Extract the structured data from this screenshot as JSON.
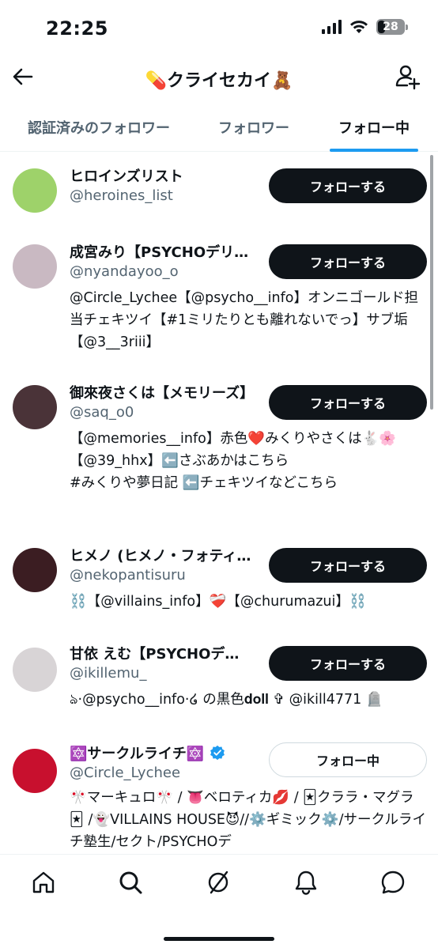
{
  "status": {
    "time": "22:25",
    "battery": "28",
    "battery_level_percent": 28
  },
  "header": {
    "title": "💊クライセカイ🧸"
  },
  "tabs": [
    {
      "label": "認証済みのフォロワー",
      "active": false
    },
    {
      "label": "フォロワー",
      "active": false
    },
    {
      "label": "フォロー中",
      "active": true
    }
  ],
  "users": [
    {
      "name": "ヒロインズリスト",
      "handle": "@heroines_list",
      "bio": "",
      "button": "フォローする",
      "avatar_color": "#9ed26a"
    },
    {
      "name": "成宮みり【PSYCHOデリ…",
      "handle": "@nyandayoo_o",
      "bio": "@Circle_Lychee【@psycho__info】オンニゴールド担当チェキツイ【#1ミリたりとも離れないでっ】サブ垢【@3__3riii】",
      "button": "フォローする",
      "avatar_color": "#c9b9c2"
    },
    {
      "name": "御來夜さくは【メモリーズ】",
      "handle": "@saq_o0",
      "bio": "【@memories__info】赤色❤️みくりやさくは🐇🌸\n【@39_hhx】⬅️さぶあかはこちら\n #みくりや夢日記 ⬅️チェキツイなどこちら",
      "button": "フォローする",
      "avatar_color": "#4a3338"
    },
    {
      "name": "ヒメノ (ヒメノ・フォティ…",
      "handle": "@nekopantisuru",
      "bio": "⛓️【@villains_info】❤️‍🩹【@churumazui】⛓️",
      "button": "フォローする",
      "avatar_color": "#3b1d22"
    },
    {
      "name": "甘依 えむ【PSYCHOデ…",
      "handle": "@ikillemu_",
      "bio": "ঌ·@psycho__info·໒ の黒色𝐝𝐨𝐥𝐥 ✞ @ikill4771 🪦",
      "button": "フォローする",
      "avatar_color": "#d8d4d6"
    },
    {
      "name": "🔯サークルライチ🔯",
      "handle": "@Circle_Lychee",
      "bio": "🎌マーキュロ🎌 / 👅ベロティカ💋 / 🃏クララ・マグラ🃏 /👻VILLAINS HOUSE😈//⚙️ギミック⚙️/サークルライチ塾生/セクト/PSYCHOデ",
      "button": "フォロー中",
      "avatar_color": "#c8102e",
      "verified": true
    }
  ],
  "nav": [
    "home-icon",
    "search-icon",
    "grok-icon",
    "notifications-icon",
    "messages-icon"
  ],
  "colors": {
    "accent": "#1d9bf0",
    "button_dark": "#0f1419",
    "secondary_text": "#536471"
  }
}
